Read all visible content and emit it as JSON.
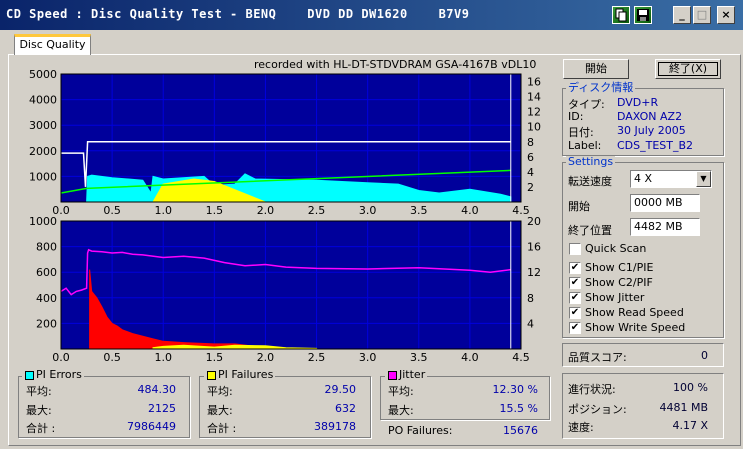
{
  "window": {
    "title": "CD Speed : Disc Quality Test - BENQ    DVD DD DW1620    B7V9",
    "minimize": "_",
    "maximize": "□",
    "close": "×"
  },
  "tab": {
    "label": "Disc Quality"
  },
  "recorded_with": "recorded with HL-DT-STDVDRAM GSA-4167B vDL10",
  "buttons": {
    "start": "開始",
    "stop": "終了(X)"
  },
  "disc_info": {
    "title": "ディスク情報",
    "type_label": "タイプ:",
    "type_value": "DVD+R",
    "id_label": "ID:",
    "id_value": "DAXON AZ2",
    "date_label": "日付:",
    "date_value": "30 July 2005",
    "label_label": "Label:",
    "label_value": "CDS_TEST_B2"
  },
  "settings": {
    "title": "Settings",
    "speed_label": "転送速度",
    "speed_value": "4 X",
    "start_label": "開始",
    "start_value": "0000 MB",
    "end_label": "終了位置",
    "end_value": "4482 MB",
    "quick_scan": "Quick Scan",
    "quick_scan_checked": false,
    "show_c1": "Show C1/PIE",
    "show_c1_checked": true,
    "show_c2": "Show C2/PIF",
    "show_c2_checked": true,
    "show_jitter": "Show Jitter",
    "show_jitter_checked": true,
    "show_read": "Show Read Speed",
    "show_read_checked": true,
    "show_write": "Show Write Speed",
    "show_write_checked": true
  },
  "quality": {
    "label": "品質スコア:",
    "value": "0"
  },
  "progress": {
    "progress_label": "進行状況:",
    "progress_value": "100 %",
    "position_label": "ポジション:",
    "position_value": "4481 MB",
    "speed_label": "速度:",
    "speed_value": "4.17 X"
  },
  "pi_errors": {
    "title": "PI Errors",
    "color": "#00ffff",
    "avg_label": "平均:",
    "avg_value": "484.30",
    "max_label": "最大:",
    "max_value": "2125",
    "total_label": "合計 :",
    "total_value": "7986449"
  },
  "pi_failures": {
    "title": "PI Failures",
    "color": "#ffff00",
    "avg_label": "平均:",
    "avg_value": "29.50",
    "max_label": "最大:",
    "max_value": "632",
    "total_label": "合計 :",
    "total_value": "389178"
  },
  "jitter": {
    "title": "Jitter",
    "color": "#ff00ff",
    "avg_label": "平均:",
    "avg_value": "12.30 %",
    "max_label": "最大:",
    "max_value": "15.5 %"
  },
  "po_failures": {
    "label": "PO Failures:",
    "value": "15676"
  },
  "chart_data": [
    {
      "type": "area",
      "x_ticks": [
        "0.0",
        "0.5",
        "1.0",
        "1.5",
        "2.0",
        "2.5",
        "3.0",
        "3.5",
        "4.0",
        "4.5"
      ],
      "y_left_ticks": [
        "5000",
        "4000",
        "3000",
        "2000",
        "1000"
      ],
      "y_right_ticks": [
        "16",
        "14",
        "12",
        "10",
        "8",
        "6",
        "4",
        "2"
      ],
      "xlim": [
        0,
        4.5
      ],
      "ylim_left": [
        0,
        5000
      ],
      "ylim_right": [
        0,
        17
      ],
      "grid": true,
      "series": [
        {
          "color": "#00ffff",
          "x": [
            0.25,
            0.26,
            0.3,
            0.5,
            0.8,
            0.88,
            0.9,
            1.0,
            1.4,
            1.5,
            1.7,
            1.8,
            1.9,
            2.5,
            3.0,
            3.3,
            3.5,
            3.7,
            4.0,
            4.3,
            4.4
          ],
          "values": [
            0,
            1000,
            1050,
            950,
            850,
            350,
            1000,
            900,
            1000,
            650,
            700,
            1100,
            900,
            850,
            750,
            700,
            450,
            350,
            500,
            300,
            200
          ]
        },
        {
          "color": "#ffff00",
          "x": [
            0.25,
            0.9,
            1.0,
            1.3,
            1.5,
            2.0,
            4.4
          ],
          "values": [
            0,
            0,
            700,
            900,
            800,
            0,
            0
          ]
        },
        {
          "color": "#00ff00",
          "x": [
            0.0,
            0.25,
            4.4
          ],
          "values": [
            1.2,
            1.8,
            4.2
          ]
        },
        {
          "color": "#ffffff",
          "x": [
            0.0,
            0.22,
            0.24,
            0.26,
            4.4
          ],
          "values": [
            6.5,
            6.5,
            2,
            8,
            8
          ]
        }
      ]
    },
    {
      "type": "bar",
      "x_ticks": [
        "0.0",
        "0.5",
        "1.0",
        "1.5",
        "2.0",
        "2.5",
        "3.0",
        "3.5",
        "4.0",
        "4.5"
      ],
      "y_left_ticks": [
        "1000",
        "800",
        "600",
        "400",
        "200"
      ],
      "y_right_ticks": [
        "20",
        "16",
        "12",
        "8",
        "4"
      ],
      "xlim": [
        0,
        4.5
      ],
      "ylim_left": [
        0,
        1000
      ],
      "ylim_right": [
        0,
        20
      ],
      "grid": true,
      "series": [
        {
          "color": "#ff00ff",
          "x": [
            0.0,
            0.05,
            0.1,
            0.15,
            0.2,
            0.25,
            0.26,
            0.27,
            0.3,
            0.4,
            0.5,
            0.6,
            0.7,
            0.8,
            1.0,
            1.2,
            1.4,
            1.6,
            1.8,
            2.0,
            2.2,
            2.5,
            3.0,
            3.5,
            4.0,
            4.2,
            4.4
          ],
          "values": [
            9,
            9.5,
            8.5,
            9,
            9.2,
            9.5,
            15,
            15.5,
            15.3,
            15.2,
            15,
            15.1,
            14.8,
            14.7,
            14.3,
            14.5,
            14.2,
            13.5,
            13,
            13.2,
            12.8,
            12.6,
            12.5,
            12.7,
            12.3,
            12,
            12.4
          ]
        },
        {
          "color": "#ff0000",
          "x": [
            0.28,
            0.3,
            0.35,
            0.4,
            0.45,
            0.5,
            0.55,
            0.6,
            0.7,
            0.8,
            0.9,
            1.0,
            1.2,
            1.5,
            1.7,
            1.9,
            2.0
          ],
          "values": [
            620,
            450,
            400,
            330,
            250,
            200,
            180,
            150,
            120,
            100,
            80,
            60,
            50,
            40,
            40,
            20,
            10
          ]
        },
        {
          "color": "#ffff00",
          "x": [
            0.9,
            1.0,
            1.2,
            1.5,
            1.7,
            2.0,
            2.2,
            2.5
          ],
          "values": [
            10,
            20,
            30,
            15,
            30,
            25,
            10,
            5
          ]
        }
      ]
    }
  ]
}
